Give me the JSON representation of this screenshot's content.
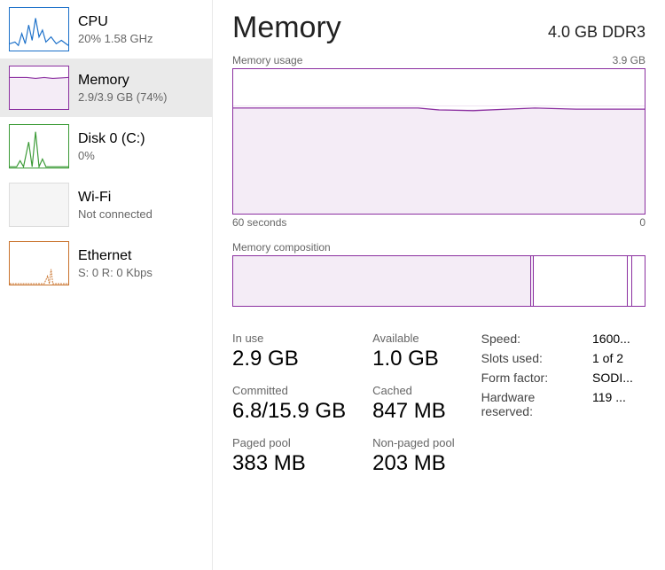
{
  "sidebar": {
    "items": [
      {
        "title": "CPU",
        "sub": "20%  1.58 GHz"
      },
      {
        "title": "Memory",
        "sub": "2.9/3.9 GB (74%)"
      },
      {
        "title": "Disk 0 (C:)",
        "sub": "0%"
      },
      {
        "title": "Wi-Fi",
        "sub": "Not connected"
      },
      {
        "title": "Ethernet",
        "sub": "S: 0  R: 0 Kbps"
      }
    ]
  },
  "header": {
    "title": "Memory",
    "capacity": "4.0 GB DDR3"
  },
  "usage_graph": {
    "top_left_label": "Memory usage",
    "top_right_label": "3.9 GB",
    "x_left": "60 seconds",
    "x_right": "0"
  },
  "composition": {
    "label": "Memory composition"
  },
  "stats": {
    "in_use": {
      "label": "In use",
      "value": "2.9 GB"
    },
    "available": {
      "label": "Available",
      "value": "1.0 GB"
    },
    "committed": {
      "label": "Committed",
      "value": "6.8/15.9 GB"
    },
    "cached": {
      "label": "Cached",
      "value": "847 MB"
    },
    "paged": {
      "label": "Paged pool",
      "value": "383 MB"
    },
    "nonpaged": {
      "label": "Non-paged pool",
      "value": "203 MB"
    }
  },
  "hardware": {
    "speed": {
      "label": "Speed:",
      "value": "1600..."
    },
    "slots": {
      "label": "Slots used:",
      "value": "1 of 2"
    },
    "form_factor": {
      "label": "Form factor:",
      "value": "SODI..."
    },
    "hw_reserved": {
      "label": "Hardware reserved:",
      "value": "119 ..."
    }
  },
  "chart_data": {
    "type": "area",
    "title": "Memory usage",
    "ylabel": "GB",
    "ylim": [
      0,
      3.9
    ],
    "x": [
      0,
      10,
      20,
      27,
      30,
      35,
      40,
      44,
      50,
      60
    ],
    "values": [
      2.85,
      2.85,
      2.85,
      2.85,
      2.8,
      2.78,
      2.82,
      2.85,
      2.82,
      2.82
    ],
    "x_range_seconds": 60,
    "composition": {
      "type": "bar_segments",
      "segments": [
        {
          "name": "in_use",
          "fraction": 0.725,
          "filled": true
        },
        {
          "name": "modified",
          "fraction": 0.005,
          "filled": true
        },
        {
          "name": "standby",
          "fraction": 0.23,
          "filled": false
        },
        {
          "name": "free",
          "fraction": 0.01,
          "filled": false
        },
        {
          "name": "cap2",
          "fraction": 0.03,
          "filled": false
        }
      ]
    }
  }
}
